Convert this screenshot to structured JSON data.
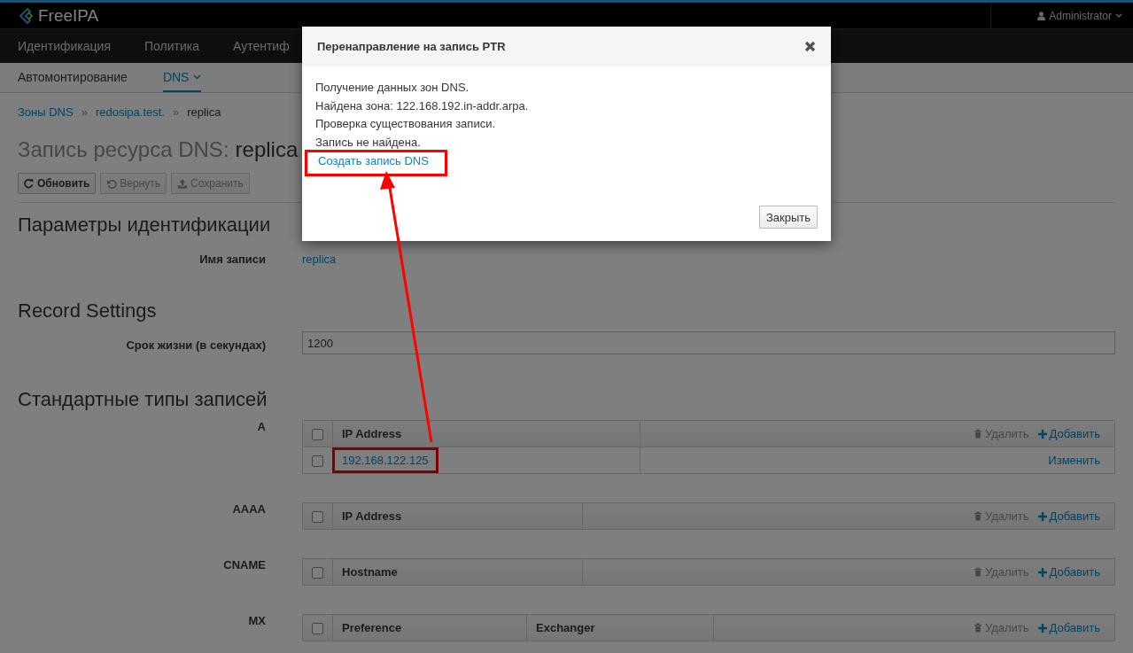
{
  "header": {
    "logo": "FreeIPA",
    "user": "Administrator"
  },
  "nav": [
    {
      "label": "Идентификация"
    },
    {
      "label": "Политика"
    },
    {
      "label": "Аутентиф"
    }
  ],
  "subnav": [
    {
      "label": "Автомонтирование",
      "selected": false
    },
    {
      "label": "DNS",
      "selected": true
    }
  ],
  "breadcrumb": [
    {
      "kind": "link",
      "label": "Зоны DNS"
    },
    {
      "kind": "separator",
      "label": "»"
    },
    {
      "kind": "link",
      "label": "redosipa.test."
    },
    {
      "kind": "separator",
      "label": "»"
    },
    {
      "kind": "current",
      "label": "replica"
    }
  ],
  "title": {
    "prefix": "Запись ресурса DNS:",
    "name": "replica"
  },
  "toolbar": [
    {
      "kind": "refresh",
      "label": "Обновить",
      "disabled": false
    },
    {
      "kind": "undo",
      "label": "Вернуть",
      "disabled": true
    },
    {
      "kind": "upload",
      "label": "Сохранить",
      "disabled": true
    }
  ],
  "sections": [
    {
      "title": "Параметры идентификации",
      "fields": [
        {
          "kind": "link",
          "label": "Имя записи",
          "value": "replica"
        }
      ]
    },
    {
      "title": "Record Settings",
      "fields": [
        {
          "kind": "input",
          "label": "Срок жизни (в секундах)",
          "value": "1200"
        }
      ]
    },
    {
      "title": "Стандартные типы записей",
      "record_tables": [
        {
          "type": "A",
          "columns": [
            "IP Address"
          ],
          "all_checked": false,
          "delete": {
            "label": "Удалить",
            "disabled": true
          },
          "add": "Добавить",
          "rows": [
            {
              "checked": false,
              "values": [
                "192.168.122.125"
              ],
              "action": "Изменить",
              "highlighted": true
            }
          ]
        },
        {
          "type": "AAAA",
          "columns": [
            "IP Address"
          ],
          "all_checked": false,
          "delete": {
            "label": "Удалить",
            "disabled": true
          },
          "add": "Добавить"
        },
        {
          "type": "CNAME",
          "columns": [
            "Hostname"
          ],
          "all_checked": false,
          "delete": {
            "label": "Удалить",
            "disabled": true
          },
          "add": "Добавить"
        },
        {
          "type": "MX",
          "columns": [
            "Preference",
            "Exchanger"
          ],
          "all_checked": false,
          "delete": {
            "label": "Удалить",
            "disabled": true
          },
          "add": "Добавить"
        }
      ]
    }
  ],
  "dialog": {
    "title": "Перенаправление на запись PTR",
    "messages": [
      "Получение данных зон DNS.",
      "Найдена зона: 122.168.192.in-addr.arpa.",
      "Проверка существования записи.",
      "Запись не найдена."
    ],
    "link": {
      "label": "Создать запись DNS",
      "highlighted": true
    },
    "close_button": "Закрыть"
  }
}
